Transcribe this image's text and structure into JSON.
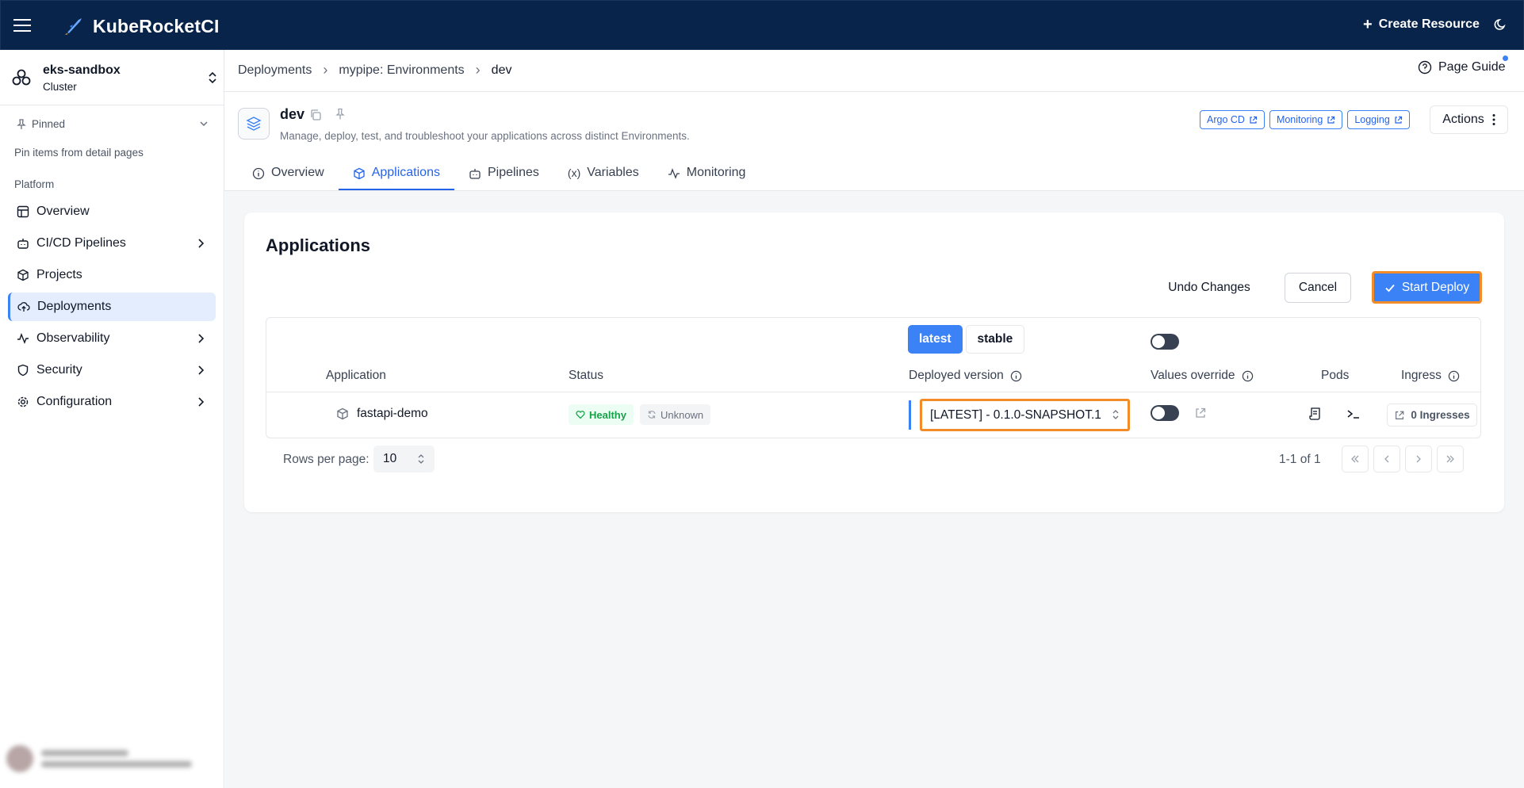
{
  "app": {
    "title": "KubeRocketCI"
  },
  "topbar": {
    "create_resource": "Create Resource"
  },
  "sidebar": {
    "cluster": {
      "name": "eks-sandbox",
      "subtitle": "Cluster"
    },
    "pinned": {
      "label": "Pinned",
      "hint": "Pin items from detail pages"
    },
    "section": "Platform",
    "items": [
      {
        "label": "Overview",
        "icon": "layout-icon"
      },
      {
        "label": "CI/CD Pipelines",
        "icon": "bot-icon"
      },
      {
        "label": "Projects",
        "icon": "box-icon"
      },
      {
        "label": "Deployments",
        "icon": "cloud-upload-icon"
      },
      {
        "label": "Observability",
        "icon": "activity-icon"
      },
      {
        "label": "Security",
        "icon": "shield-icon"
      },
      {
        "label": "Configuration",
        "icon": "gear-icon"
      }
    ]
  },
  "breadcrumbs": [
    "Deployments",
    "mypipe: Environments",
    "dev"
  ],
  "page_guide": "Page Guide",
  "environment": {
    "name": "dev",
    "description": "Manage, deploy, test, and troubleshoot your applications across distinct Environments.",
    "links": [
      "Argo CD",
      "Monitoring",
      "Logging"
    ],
    "actions": "Actions"
  },
  "tabs": [
    "Overview",
    "Applications",
    "Pipelines",
    "Variables",
    "Monitoring"
  ],
  "applications": {
    "title": "Applications",
    "undo": "Undo Changes",
    "cancel": "Cancel",
    "deploy": "Start Deploy",
    "segment": {
      "latest": "latest",
      "stable": "stable"
    },
    "columns": {
      "application": "Application",
      "status": "Status",
      "deployed_version": "Deployed version",
      "values_override": "Values override",
      "pods": "Pods",
      "ingress": "Ingress"
    },
    "rows": [
      {
        "name": "fastapi-demo",
        "health": "Healthy",
        "sync": "Unknown",
        "version": "[LATEST] - 0.1.0-SNAPSHOT.1",
        "ingresses": "0 Ingresses"
      }
    ],
    "rows_per_page_label": "Rows per page:",
    "rows_per_page": "10",
    "page_info": "1-1 of 1"
  },
  "colors": {
    "topbar": "#08244a",
    "accent": "#3b82f6",
    "highlight": "#f28c28",
    "healthy": "#16a34a"
  }
}
